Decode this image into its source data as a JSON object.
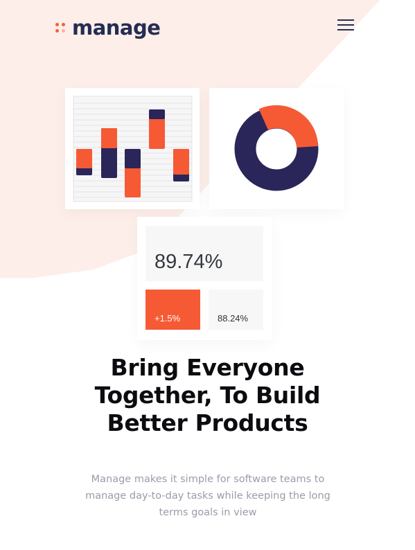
{
  "brand": {
    "name": "manage",
    "text_color": "#242d52",
    "accent": "#f25f3a",
    "background_tint": "#fdeeea"
  },
  "header": {
    "menu_icon": "hamburger-menu-icon"
  },
  "hero_illustration": {
    "bar_card": {
      "colors": {
        "primary": "#f65a35",
        "secondary": "#2a2659"
      }
    },
    "donut_card": {
      "colors": {
        "primary": "#f65a35",
        "secondary": "#2a2659"
      }
    },
    "stats_card": {
      "main_value": "89.74%",
      "change_value": "+1.5%",
      "secondary_value": "88.24%"
    }
  },
  "hero": {
    "headline_lines": [
      "Bring Everyone",
      "Together, To Build",
      "Better Products"
    ],
    "description_lines": [
      "Manage makes it simple for software teams to",
      "manage day-to-day tasks while keeping the long",
      "terms goals in view"
    ]
  }
}
